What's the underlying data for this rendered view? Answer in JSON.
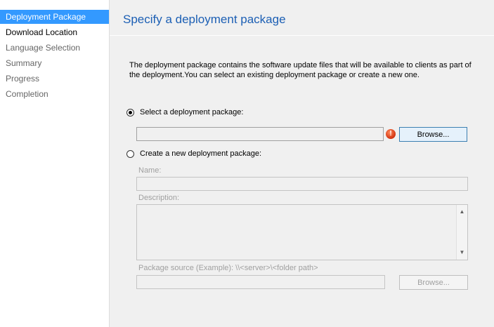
{
  "sidebar": {
    "items": [
      {
        "label": "Deployment Package",
        "state": "active"
      },
      {
        "label": "Download Location",
        "state": "next"
      },
      {
        "label": "Language Selection",
        "state": "pending"
      },
      {
        "label": "Summary",
        "state": "pending"
      },
      {
        "label": "Progress",
        "state": "pending"
      },
      {
        "label": "Completion",
        "state": "pending"
      }
    ]
  },
  "main": {
    "title": "Specify a deployment package",
    "description": "The deployment package contains the software update files that will be available to clients as part of the deployment.You can select an existing deployment package or create a new one.",
    "select_existing": {
      "label": "Select a deployment package:",
      "selected": true,
      "value": "",
      "error_icon": "error-exclamation-icon",
      "browse_label": "Browse..."
    },
    "create_new": {
      "label": "Create a new deployment package:",
      "selected": false,
      "name_label": "Name:",
      "name_value": "",
      "description_label": "Description:",
      "description_value": "",
      "source_label": "Package source (Example): \\\\<server>\\<folder path>",
      "source_value": "",
      "browse_label": "Browse..."
    }
  },
  "colors": {
    "accent": "#3399ff",
    "title": "#1c5fb4",
    "error": "#d2320f",
    "background": "#f0f0f0"
  }
}
